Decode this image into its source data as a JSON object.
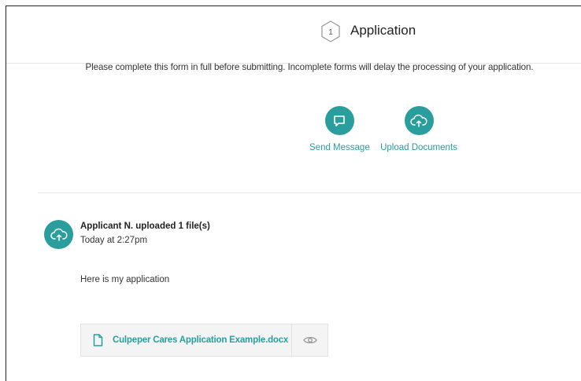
{
  "header": {
    "step_number": "1",
    "title": "Application"
  },
  "instructions": "Please complete this form in full before submitting. Incomplete forms will delay the processing of your application.",
  "actions": [
    {
      "label": "Send Message",
      "icon": "chat-bubble-icon"
    },
    {
      "label": "Upload Documents",
      "icon": "cloud-upload-icon"
    }
  ],
  "activity": {
    "icon": "cloud-upload-icon",
    "title": "Applicant N. uploaded 1 file(s)",
    "timestamp": "Today at 2:27pm",
    "message": "Here is my application",
    "attachment": {
      "file_name": "Culpeper Cares Application Example.docx",
      "file_icon": "document-icon",
      "preview_icon": "eye-icon"
    }
  },
  "colors": {
    "accent": "#2a9d9d",
    "attachment_bg": "#f4f4f4"
  }
}
